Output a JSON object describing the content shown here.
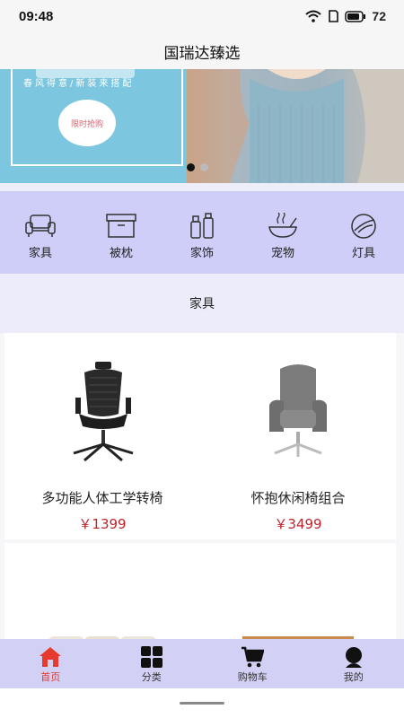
{
  "status_bar": {
    "time": "09:48",
    "battery": "72"
  },
  "header": {
    "title": "国瑞达臻选"
  },
  "banner": {
    "subtitle": "春风得意/新装来搭配",
    "cta": "限时抢购"
  },
  "categories": [
    {
      "label": "家具",
      "icon": "sofa-icon"
    },
    {
      "label": "被枕",
      "icon": "storage-box-icon"
    },
    {
      "label": "家饰",
      "icon": "bottles-icon"
    },
    {
      "label": "宠物",
      "icon": "pet-bowl-icon"
    },
    {
      "label": "灯具",
      "icon": "lamp-icon"
    }
  ],
  "section": {
    "title": "家具"
  },
  "products": [
    {
      "name": "多功能人体工学转椅",
      "price": "￥1399"
    },
    {
      "name": "怀抱休闲椅组合",
      "price": "￥3499"
    },
    {
      "name": "",
      "price": ""
    },
    {
      "name": "",
      "price": ""
    }
  ],
  "tabs": [
    {
      "label": "首页",
      "icon": "home-icon",
      "active": true
    },
    {
      "label": "分类",
      "icon": "grid-icon",
      "active": false
    },
    {
      "label": "购物车",
      "icon": "cart-icon",
      "active": false
    },
    {
      "label": "我的",
      "icon": "user-icon",
      "active": false
    }
  ],
  "colors": {
    "accent": "#e53a2d",
    "price": "#c0222a",
    "category_bg": "#cfcef8",
    "tab_bg": "#d3d0f5"
  }
}
